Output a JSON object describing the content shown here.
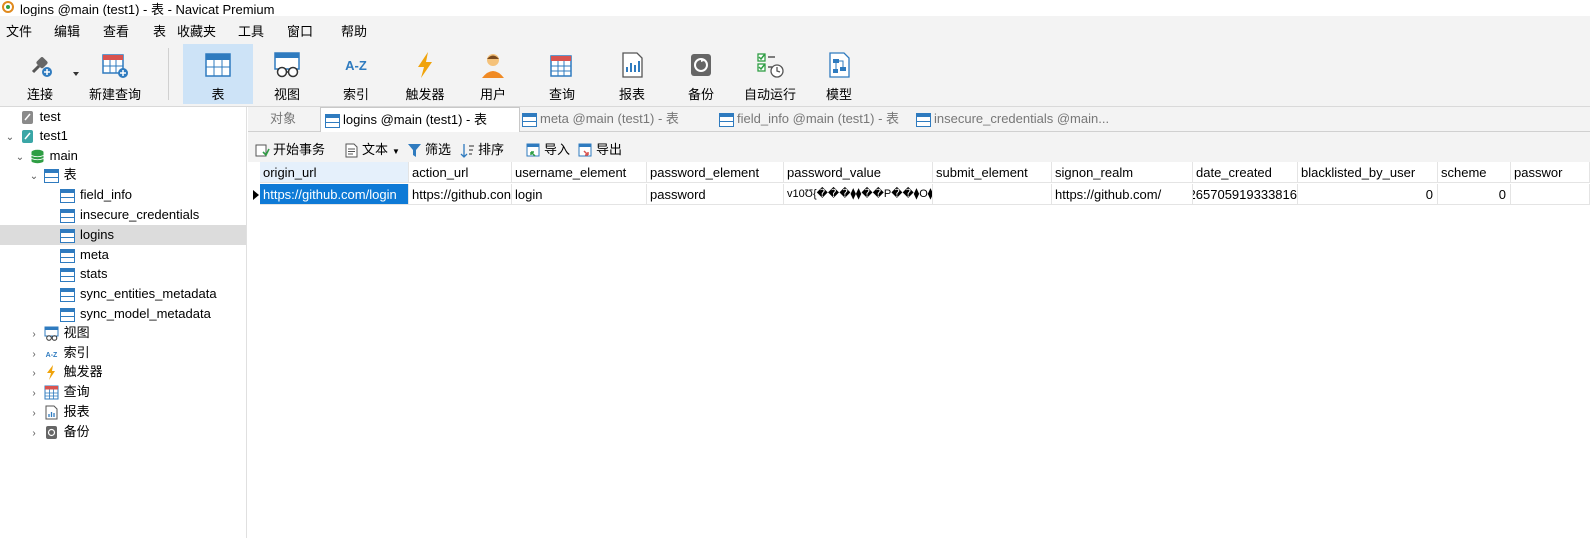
{
  "window": {
    "title": "logins @main (test1) - 表 - Navicat Premium"
  },
  "menu": [
    "文件",
    "编辑",
    "查看",
    "表",
    "收藏夹",
    "工具",
    "窗口",
    "帮助"
  ],
  "toolbar": {
    "connect": "连接",
    "new_query": "新建查询",
    "table": "表",
    "view": "视图",
    "index": "索引",
    "trigger": "触发器",
    "user": "用户",
    "query": "查询",
    "report": "报表",
    "backup": "备份",
    "automation": "自动运行",
    "model": "模型"
  },
  "tree": {
    "conn1": "test",
    "conn2": "test1",
    "db": "main",
    "tables_folder": "表",
    "tables": [
      "field_info",
      "insecure_credentials",
      "logins",
      "meta",
      "stats",
      "sync_entities_metadata",
      "sync_model_metadata"
    ],
    "views": "视图",
    "indexes": "索引",
    "triggers": "触发器",
    "queries": "查询",
    "reports": "报表",
    "backups": "备份"
  },
  "tabs": {
    "objects": "对象",
    "items": [
      "logins @main (test1) - 表",
      "meta @main (test1) - 表",
      "field_info @main (test1) - 表",
      "insecure_credentials @main..."
    ]
  },
  "subtoolbar": {
    "begin_transaction": "开始事务",
    "text": "文本",
    "filter": "筛选",
    "sort": "排序",
    "import": "导入",
    "export": "导出"
  },
  "grid": {
    "columns": [
      "origin_url",
      "action_url",
      "username_element",
      "password_element",
      "password_value",
      "submit_element",
      "signon_realm",
      "date_created",
      "blacklisted_by_user",
      "scheme",
      "passwor"
    ],
    "row": [
      "https://github.com/login",
      "https://github.con",
      "login",
      "password",
      "v10Ʊ{���⧫⧫��P��⧫O⧫��:",
      "",
      "https://github.com/",
      "265705919333816",
      "0",
      "0",
      ""
    ]
  }
}
